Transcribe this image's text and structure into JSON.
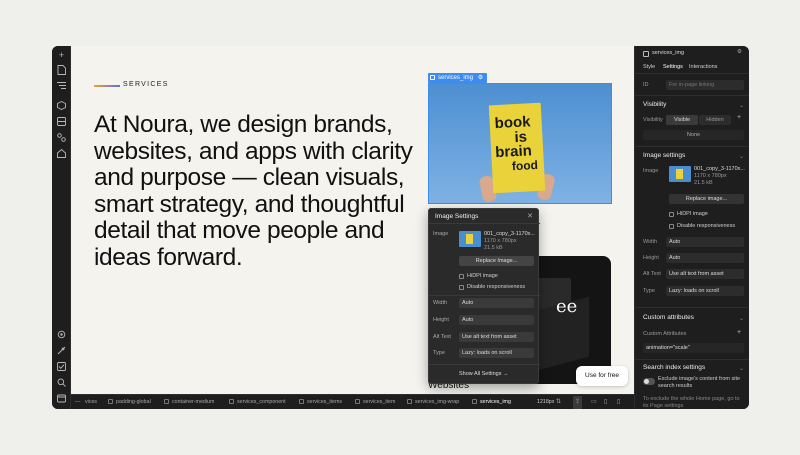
{
  "left_toolbar": {
    "icons": [
      "plus-icon",
      "page-icon",
      "navigator-icon",
      "components-icon",
      "box-icon",
      "assets-icon",
      "cms-icon",
      "apps-icon",
      "settings-icon",
      "audit-icon",
      "check-icon",
      "search-icon",
      "help-icon"
    ]
  },
  "canvas": {
    "section_label": "SERVICES",
    "headline": "At Noura, we design brands, websites, and apps with clarity and purpose — clean visuals, smart strategy, and thoughtful detail that move people and ideas forward.",
    "selection_tag": "services_img",
    "book_lines": [
      "book",
      "is",
      "brain",
      "food"
    ],
    "websites_label": "Websites",
    "use_for_free": "Use for free"
  },
  "image_popup": {
    "title": "Image Settings",
    "image_label": "Image",
    "file_name": "001_copy_3-1170x...",
    "dimensions": "1170 x 780px",
    "size": "21.5 kB",
    "replace_button": "Replace Image...",
    "hidpi": "HiDPI image",
    "disable_resp": "Disable responsiveness",
    "width_label": "Width",
    "width_value": "Auto",
    "height_label": "Height",
    "height_value": "Auto",
    "alt_label": "Alt Text",
    "alt_value": "Use alt text from asset",
    "type_label": "Type",
    "type_value": "Lazy: loads on scroll",
    "show_all": "Show All Settings"
  },
  "right_panel": {
    "element_name": "services_img",
    "tabs": [
      "Style",
      "Settings",
      "Interactions"
    ],
    "id_label": "ID",
    "id_placeholder": "For in-page linking",
    "visibility_section": "Visibility",
    "visibility_label": "Visibility",
    "visible": "Visible",
    "hidden": "Hidden",
    "display_value": "None",
    "image_section": "Image settings",
    "image_label": "Image",
    "file_name": "001_copy_3-1170x...",
    "dimensions": "1170 x 780px",
    "size": "21.5 kB",
    "replace_button": "Replace image...",
    "hidpi": "HiDPI image",
    "disable_resp": "Disable responsiveness",
    "width_label": "Width",
    "width_value": "Auto",
    "height_label": "Height",
    "height_value": "Auto",
    "alt_label": "Alt Text",
    "alt_value": "Use alt text from asset",
    "type_label": "Type",
    "type_value": "Lazy: loads on scroll",
    "custom_section": "Custom attributes",
    "custom_label": "Custom Attributes",
    "custom_value": "animation=\"scale\"",
    "search_section": "Search index settings",
    "search_exclude": "Exclude image's content from site search results",
    "search_note": "To exclude the whole Home page, go to its Page settings"
  },
  "bottom_bar": {
    "crumbs": [
      "vices",
      "padding-global",
      "container-medium",
      "services_component",
      "services_items",
      "services_item",
      "services_img-wrap",
      "services_img"
    ],
    "width_readout": "1218px"
  },
  "colors": {
    "selection_blue": "#3d8cf0",
    "panel_bg": "#1e1e1e",
    "canvas_bg": "#f4f3ee",
    "book_yellow": "#e9d23a"
  }
}
